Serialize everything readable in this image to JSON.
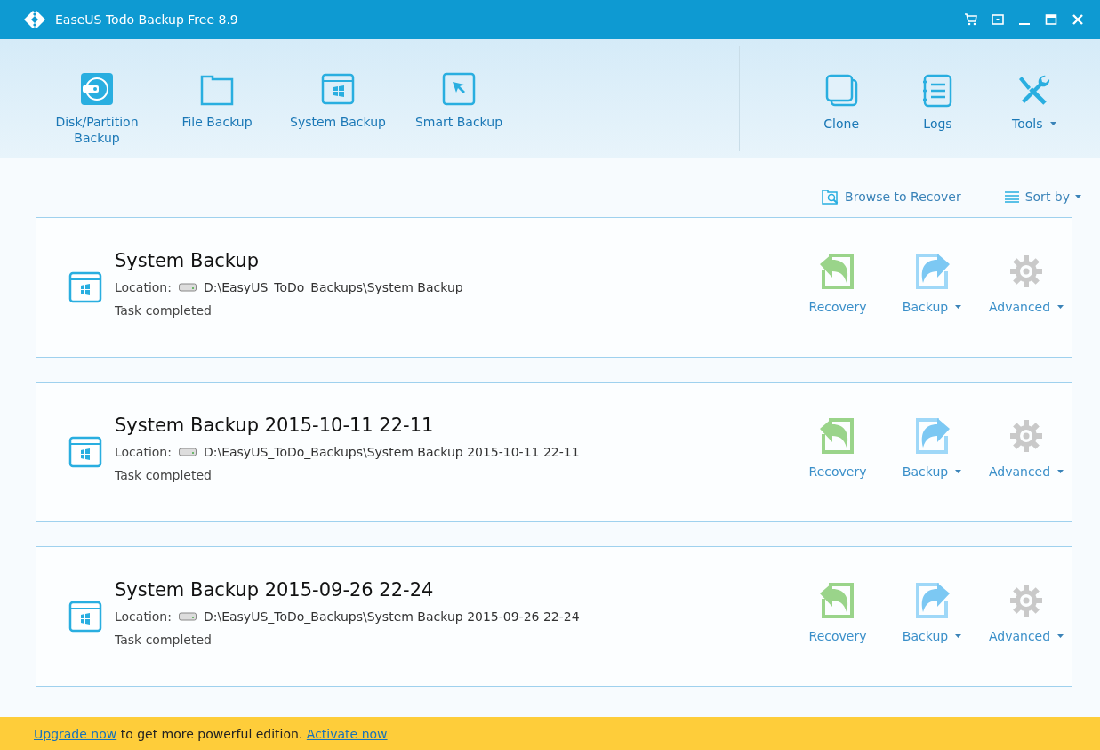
{
  "window": {
    "title": "EaseUS Todo Backup Free 8.9"
  },
  "title_buttons": [
    {
      "kind": "cart"
    },
    {
      "kind": "menu"
    },
    {
      "kind": "minimize"
    },
    {
      "kind": "maximize"
    },
    {
      "kind": "close"
    }
  ],
  "toolbar_left": [
    {
      "kind": "disk",
      "label": "Disk/Partition\nBackup"
    },
    {
      "kind": "file",
      "label": "File Backup"
    },
    {
      "kind": "system",
      "label": "System Backup"
    },
    {
      "kind": "smart",
      "label": "Smart Backup"
    }
  ],
  "toolbar_right": [
    {
      "kind": "clone",
      "label": "Clone",
      "dropdown": false
    },
    {
      "kind": "logs",
      "label": "Logs",
      "dropdown": false
    },
    {
      "kind": "tools",
      "label": "Tools",
      "dropdown": true
    }
  ],
  "actions": [
    {
      "kind": "browse",
      "label": "Browse to Recover",
      "dropdown": false
    },
    {
      "kind": "sort",
      "label": "Sort by",
      "dropdown": true
    }
  ],
  "tasks": [
    {
      "title": "System Backup",
      "location_label": "Location:",
      "location": "D:\\EasyUS_ToDo_Backups\\System Backup",
      "status": "Task completed",
      "buttons": [
        {
          "kind": "recovery",
          "label": "Recovery",
          "dropdown": false
        },
        {
          "kind": "backup",
          "label": "Backup",
          "dropdown": true
        },
        {
          "kind": "advanced",
          "label": "Advanced",
          "dropdown": true
        }
      ]
    },
    {
      "title": "System Backup 2015-10-11 22-11",
      "location_label": "Location:",
      "location": "D:\\EasyUS_ToDo_Backups\\System Backup 2015-10-11 22-11",
      "status": "Task completed",
      "buttons": [
        {
          "kind": "recovery",
          "label": "Recovery",
          "dropdown": false
        },
        {
          "kind": "backup",
          "label": "Backup",
          "dropdown": true
        },
        {
          "kind": "advanced",
          "label": "Advanced",
          "dropdown": true
        }
      ]
    },
    {
      "title": "System Backup 2015-09-26 22-24",
      "location_label": "Location:",
      "location": "D:\\EasyUS_ToDo_Backups\\System Backup 2015-09-26 22-24",
      "status": "Task completed",
      "buttons": [
        {
          "kind": "recovery",
          "label": "Recovery",
          "dropdown": false
        },
        {
          "kind": "backup",
          "label": "Backup",
          "dropdown": true
        },
        {
          "kind": "advanced",
          "label": "Advanced",
          "dropdown": true
        }
      ]
    }
  ],
  "footer": {
    "parts": [
      {
        "kind": "link",
        "text": "Upgrade now"
      },
      {
        "kind": "text",
        "text": " to get more powerful edition. "
      },
      {
        "kind": "link",
        "text": "Activate now"
      }
    ]
  }
}
